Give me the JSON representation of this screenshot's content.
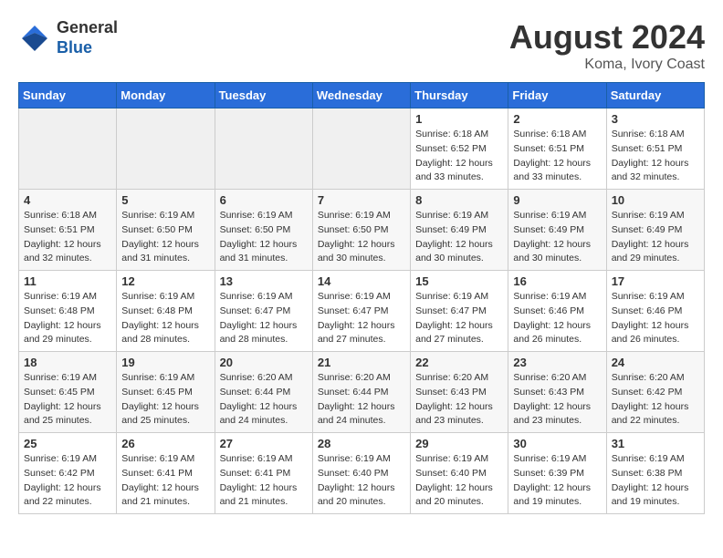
{
  "header": {
    "logo_line1": "General",
    "logo_line2": "Blue",
    "month_year": "August 2024",
    "location": "Koma, Ivory Coast"
  },
  "days_of_week": [
    "Sunday",
    "Monday",
    "Tuesday",
    "Wednesday",
    "Thursday",
    "Friday",
    "Saturday"
  ],
  "weeks": [
    [
      {
        "day": "",
        "empty": true
      },
      {
        "day": "",
        "empty": true
      },
      {
        "day": "",
        "empty": true
      },
      {
        "day": "",
        "empty": true
      },
      {
        "day": "1",
        "sunrise": "6:18 AM",
        "sunset": "6:52 PM",
        "daylight": "12 hours and 33 minutes."
      },
      {
        "day": "2",
        "sunrise": "6:18 AM",
        "sunset": "6:51 PM",
        "daylight": "12 hours and 33 minutes."
      },
      {
        "day": "3",
        "sunrise": "6:18 AM",
        "sunset": "6:51 PM",
        "daylight": "12 hours and 32 minutes."
      }
    ],
    [
      {
        "day": "4",
        "sunrise": "6:18 AM",
        "sunset": "6:51 PM",
        "daylight": "12 hours and 32 minutes."
      },
      {
        "day": "5",
        "sunrise": "6:19 AM",
        "sunset": "6:50 PM",
        "daylight": "12 hours and 31 minutes."
      },
      {
        "day": "6",
        "sunrise": "6:19 AM",
        "sunset": "6:50 PM",
        "daylight": "12 hours and 31 minutes."
      },
      {
        "day": "7",
        "sunrise": "6:19 AM",
        "sunset": "6:50 PM",
        "daylight": "12 hours and 30 minutes."
      },
      {
        "day": "8",
        "sunrise": "6:19 AM",
        "sunset": "6:49 PM",
        "daylight": "12 hours and 30 minutes."
      },
      {
        "day": "9",
        "sunrise": "6:19 AM",
        "sunset": "6:49 PM",
        "daylight": "12 hours and 30 minutes."
      },
      {
        "day": "10",
        "sunrise": "6:19 AM",
        "sunset": "6:49 PM",
        "daylight": "12 hours and 29 minutes."
      }
    ],
    [
      {
        "day": "11",
        "sunrise": "6:19 AM",
        "sunset": "6:48 PM",
        "daylight": "12 hours and 29 minutes."
      },
      {
        "day": "12",
        "sunrise": "6:19 AM",
        "sunset": "6:48 PM",
        "daylight": "12 hours and 28 minutes."
      },
      {
        "day": "13",
        "sunrise": "6:19 AM",
        "sunset": "6:47 PM",
        "daylight": "12 hours and 28 minutes."
      },
      {
        "day": "14",
        "sunrise": "6:19 AM",
        "sunset": "6:47 PM",
        "daylight": "12 hours and 27 minutes."
      },
      {
        "day": "15",
        "sunrise": "6:19 AM",
        "sunset": "6:47 PM",
        "daylight": "12 hours and 27 minutes."
      },
      {
        "day": "16",
        "sunrise": "6:19 AM",
        "sunset": "6:46 PM",
        "daylight": "12 hours and 26 minutes."
      },
      {
        "day": "17",
        "sunrise": "6:19 AM",
        "sunset": "6:46 PM",
        "daylight": "12 hours and 26 minutes."
      }
    ],
    [
      {
        "day": "18",
        "sunrise": "6:19 AM",
        "sunset": "6:45 PM",
        "daylight": "12 hours and 25 minutes."
      },
      {
        "day": "19",
        "sunrise": "6:19 AM",
        "sunset": "6:45 PM",
        "daylight": "12 hours and 25 minutes."
      },
      {
        "day": "20",
        "sunrise": "6:20 AM",
        "sunset": "6:44 PM",
        "daylight": "12 hours and 24 minutes."
      },
      {
        "day": "21",
        "sunrise": "6:20 AM",
        "sunset": "6:44 PM",
        "daylight": "12 hours and 24 minutes."
      },
      {
        "day": "22",
        "sunrise": "6:20 AM",
        "sunset": "6:43 PM",
        "daylight": "12 hours and 23 minutes."
      },
      {
        "day": "23",
        "sunrise": "6:20 AM",
        "sunset": "6:43 PM",
        "daylight": "12 hours and 23 minutes."
      },
      {
        "day": "24",
        "sunrise": "6:20 AM",
        "sunset": "6:42 PM",
        "daylight": "12 hours and 22 minutes."
      }
    ],
    [
      {
        "day": "25",
        "sunrise": "6:19 AM",
        "sunset": "6:42 PM",
        "daylight": "12 hours and 22 minutes."
      },
      {
        "day": "26",
        "sunrise": "6:19 AM",
        "sunset": "6:41 PM",
        "daylight": "12 hours and 21 minutes."
      },
      {
        "day": "27",
        "sunrise": "6:19 AM",
        "sunset": "6:41 PM",
        "daylight": "12 hours and 21 minutes."
      },
      {
        "day": "28",
        "sunrise": "6:19 AM",
        "sunset": "6:40 PM",
        "daylight": "12 hours and 20 minutes."
      },
      {
        "day": "29",
        "sunrise": "6:19 AM",
        "sunset": "6:40 PM",
        "daylight": "12 hours and 20 minutes."
      },
      {
        "day": "30",
        "sunrise": "6:19 AM",
        "sunset": "6:39 PM",
        "daylight": "12 hours and 19 minutes."
      },
      {
        "day": "31",
        "sunrise": "6:19 AM",
        "sunset": "6:38 PM",
        "daylight": "12 hours and 19 minutes."
      }
    ]
  ]
}
